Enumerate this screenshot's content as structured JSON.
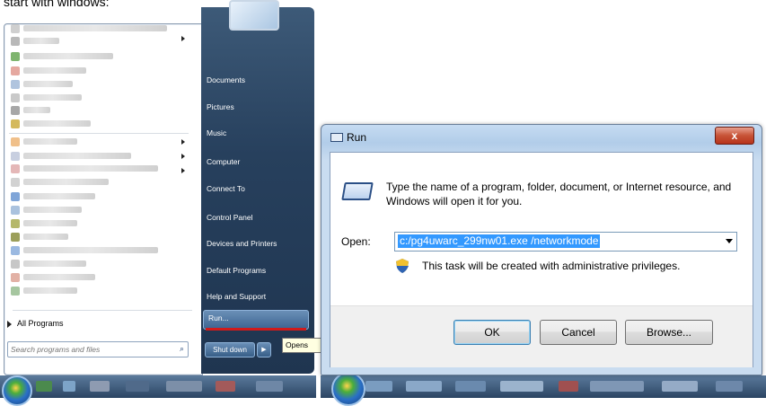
{
  "caption": "start with windows:",
  "start_menu": {
    "right_items": [
      "Documents",
      "Pictures",
      "Music",
      "Computer",
      "Connect To",
      "Control Panel",
      "Devices and Printers",
      "Default Programs",
      "Help and Support"
    ],
    "run_label": "Run...",
    "all_programs": "All Programs",
    "search_placeholder": "Search programs and files",
    "shutdown_label": "Shut down",
    "tooltip": "Opens"
  },
  "run_dialog": {
    "title": "Run",
    "close": "x",
    "description": "Type the name of a program, folder, document, or Internet resource, and Windows will open it for you.",
    "open_label": "Open:",
    "open_value": "c:/pg4uwarc_299nw01.exe /networkmode",
    "admin_note": "This task will be created with administrative privileges.",
    "ok": "OK",
    "cancel": "Cancel",
    "browse": "Browse..."
  },
  "colors": {
    "accent_red": "#d11b1b",
    "selection_blue": "#3399ff",
    "close_red": "#c75336"
  }
}
